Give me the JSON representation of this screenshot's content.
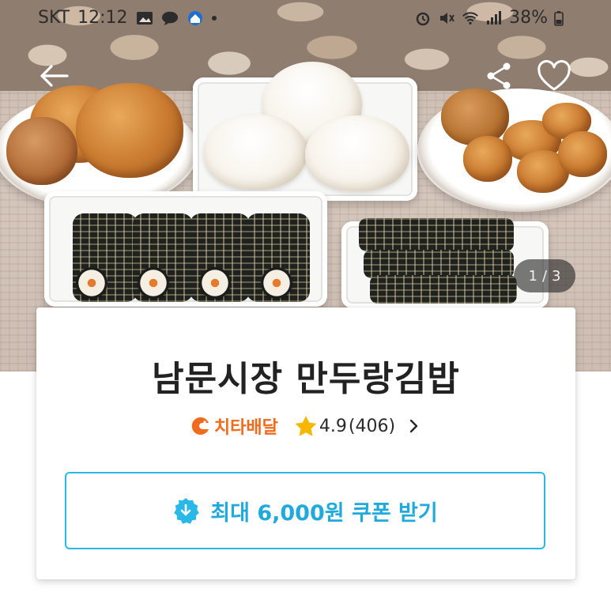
{
  "status_bar": {
    "carrier": "SKT",
    "time": "12:12",
    "battery": "38%"
  },
  "nav": {
    "back_icon": "arrow-left-icon",
    "share_icon": "share-icon",
    "favorite_icon": "heart-outline-icon"
  },
  "carousel": {
    "current": "1",
    "separator": "/",
    "total": "3"
  },
  "store": {
    "name": "남문시장 만두랑김밥",
    "delivery_brand": "치타배달",
    "rating": "4.9",
    "review_count": "(406)",
    "chevron_icon": "chevron-right-icon"
  },
  "coupon": {
    "label": "최대 6,000원 쿠폰 받기",
    "icon": "download-badge-icon"
  },
  "colors": {
    "accent_blue": "#2ab8e8",
    "brand_orange": "#f26a1b",
    "star_yellow": "#f6b700"
  }
}
